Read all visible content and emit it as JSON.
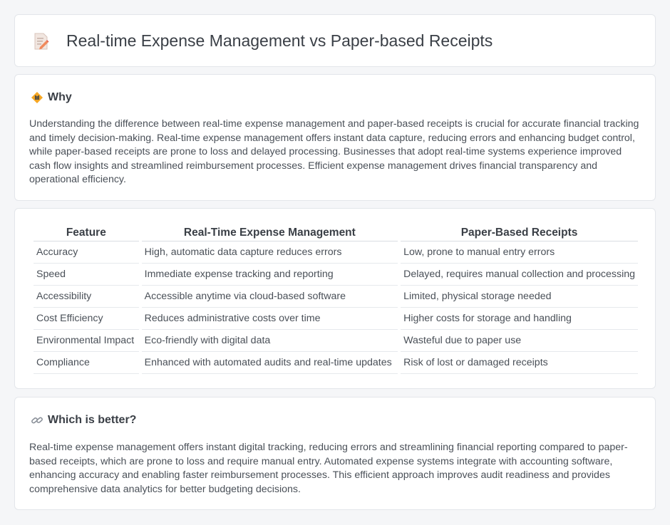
{
  "header": {
    "title": "Real-time Expense Management vs Paper-based Receipts",
    "icon": "document-pencil-icon"
  },
  "why": {
    "heading": "Why",
    "icon": "diamond-signal-icon",
    "text": "Understanding the difference between real-time expense management and paper-based receipts is crucial for accurate financial tracking and timely decision-making. Real-time expense management offers instant data capture, reducing errors and enhancing budget control, while paper-based receipts are prone to loss and delayed processing. Businesses that adopt real-time systems experience improved cash flow insights and streamlined reimbursement processes. Efficient expense management drives financial transparency and operational efficiency."
  },
  "table": {
    "headers": [
      "Feature",
      "Real-Time Expense Management",
      "Paper-Based Receipts"
    ],
    "rows": [
      [
        "Accuracy",
        "High, automatic data capture reduces errors",
        "Low, prone to manual entry errors"
      ],
      [
        "Speed",
        "Immediate expense tracking and reporting",
        "Delayed, requires manual collection and processing"
      ],
      [
        "Accessibility",
        "Accessible anytime via cloud-based software",
        "Limited, physical storage needed"
      ],
      [
        "Cost Efficiency",
        "Reduces administrative costs over time",
        "Higher costs for storage and handling"
      ],
      [
        "Environmental Impact",
        "Eco-friendly with digital data",
        "Wasteful due to paper use"
      ],
      [
        "Compliance",
        "Enhanced with automated audits and real-time updates",
        "Risk of lost or damaged receipts"
      ]
    ]
  },
  "better": {
    "heading": "Which is better?",
    "icon": "link-icon",
    "text": "Real-time expense management offers instant digital tracking, reducing errors and streamlining financial reporting compared to paper-based receipts, which are prone to loss and require manual entry. Automated expense systems integrate with accounting software, enhancing accuracy and enabling faster reimbursement processes. This efficient approach improves audit readiness and provides comprehensive data analytics for better budgeting decisions."
  }
}
